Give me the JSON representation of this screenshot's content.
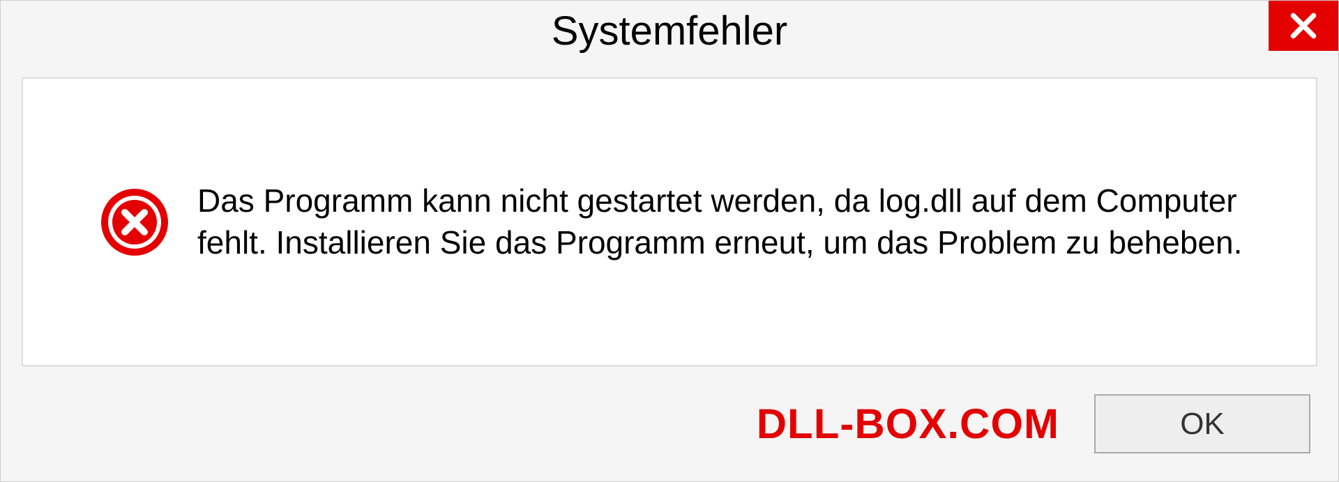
{
  "dialog": {
    "title": "Systemfehler",
    "message": "Das Programm kann nicht gestartet werden, da log.dll auf dem Computer fehlt. Installieren Sie das Programm erneut, um das Problem zu beheben.",
    "ok_label": "OK"
  },
  "watermark": "DLL-BOX.COM"
}
